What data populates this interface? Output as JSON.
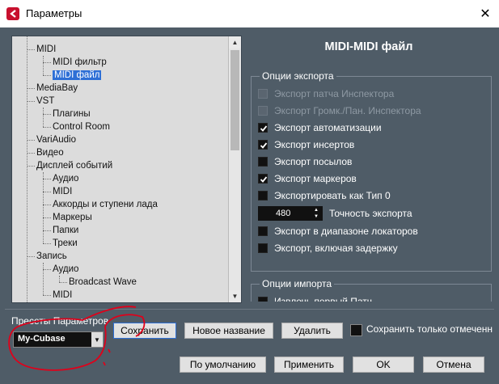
{
  "window": {
    "title": "Параметры",
    "close_glyph": "✕"
  },
  "tree": {
    "items": [
      {
        "label": "MIDI"
      },
      {
        "label": "MIDI фильтр"
      },
      {
        "label": "MIDI файл"
      },
      {
        "label": "MediaBay"
      },
      {
        "label": "VST"
      },
      {
        "label": "Плагины"
      },
      {
        "label": "Control Room"
      },
      {
        "label": "VariAudio"
      },
      {
        "label": "Видео"
      },
      {
        "label": "Дисплей событий"
      },
      {
        "label": "Аудио"
      },
      {
        "label": "MIDI"
      },
      {
        "label": "Аккорды и ступени лада"
      },
      {
        "label": "Маркеры"
      },
      {
        "label": "Папки"
      },
      {
        "label": "Треки"
      },
      {
        "label": "Запись"
      },
      {
        "label": "Аудио"
      },
      {
        "label": "Broadcast Wave"
      },
      {
        "label": "MIDI"
      }
    ],
    "selected": "MIDI файл"
  },
  "panel": {
    "title": "MIDI-MIDI файл",
    "export_group": "Опции экспорта",
    "export_options": [
      {
        "label": "Экспорт патча Инспектора",
        "checked": false,
        "disabled": true
      },
      {
        "label": "Экспорт Громк./Пан. Инспектора",
        "checked": false,
        "disabled": true
      },
      {
        "label": "Экспорт автоматизации",
        "checked": true,
        "disabled": false
      },
      {
        "label": "Экспорт инсертов",
        "checked": true,
        "disabled": false
      },
      {
        "label": "Экспорт посылов",
        "checked": false,
        "disabled": false
      },
      {
        "label": "Экспорт маркеров",
        "checked": true,
        "disabled": false
      },
      {
        "label": "Экспортировать как Тип 0",
        "checked": false,
        "disabled": false
      },
      {
        "label": "Экспорт в диапазоне локаторов",
        "checked": false,
        "disabled": false
      },
      {
        "label": "Экспорт, включая задержку",
        "checked": false,
        "disabled": false
      }
    ],
    "resolution_value": "480",
    "resolution_label": "Точность экспорта",
    "import_group": "Опции импорта",
    "import_options": [
      {
        "label": "Извлечь первый Патч",
        "checked": false
      }
    ]
  },
  "presets": {
    "label": "Пресеты Параметров",
    "selected": "My-Cubase",
    "save": "Сохранить",
    "new_name": "Новое название",
    "delete": "Удалить",
    "save_only_checked": "Сохранить только отмеченн"
  },
  "footer": {
    "defaults": "По умолчанию",
    "apply": "Применить",
    "ok": "OK",
    "cancel": "Отмена"
  },
  "colors": {
    "accent": "#2d6fd6",
    "annotation": "#e0001a",
    "dialog_bg": "#4f5c67"
  }
}
